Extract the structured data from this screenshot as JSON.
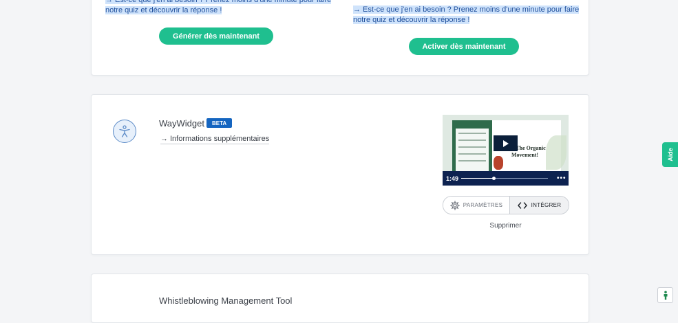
{
  "top_card": {
    "left_text": "→ Est-ce que j'en ai besoin ? Prenez moins d'une minute pour faire notre quiz et découvrir la réponse !",
    "right_text": "→ Est-ce que j'en ai besoin ? Prenez moins d'une minute pour faire notre quiz et découvrir la réponse !",
    "generate_label": "Générer dès maintenant",
    "activate_label": "Activer dès maintenant"
  },
  "waywidget": {
    "title": "WayWidget",
    "badge": "BETA",
    "info_link": "Informations supplémentaires",
    "video": {
      "headline_line1": "n The Organic",
      "headline_line2": "Movement!",
      "duration": "1:49",
      "progress": 0.38,
      "more": "•••"
    },
    "settings_label": "PARAMÈTRES",
    "integrate_label": "INTÉGRER",
    "delete_label": "Supprimer"
  },
  "whistleblowing": {
    "title": "Whistleblowing Management Tool"
  },
  "help_tab": {
    "label": "Aide"
  },
  "colors": {
    "accent_green": "#1fbf8f",
    "badge_blue": "#1565c0",
    "video_bar": "#0d2250",
    "highlight": "#cfe3fb"
  },
  "icons": {
    "logo": "accessibility-person-icon",
    "info_arrow": "arrow-right-icon",
    "settings": "gear-icon",
    "integrate": "code-icon",
    "play": "play-icon",
    "a11y": "accessibility-icon"
  }
}
